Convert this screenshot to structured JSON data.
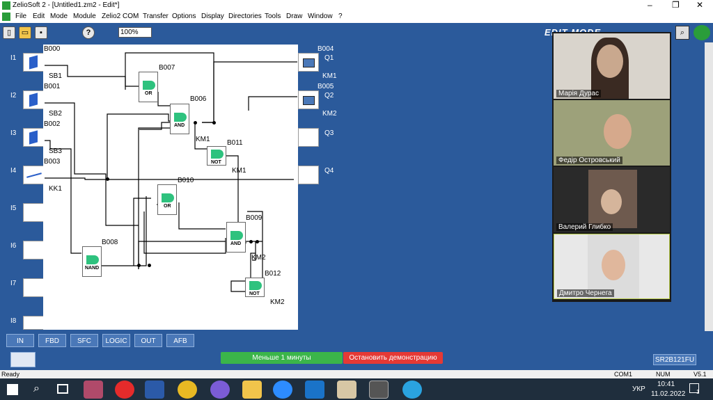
{
  "window": {
    "title": "ZelioSoft 2 - [Untitled1.zm2 - Edit*]",
    "controls": [
      "–",
      "❐",
      "✕"
    ]
  },
  "menu": [
    "File",
    "Edit",
    "Mode",
    "Module",
    "Zelio2 COM",
    "Transfer",
    "Options",
    "Display",
    "Directories",
    "Tools",
    "Draw",
    "Window",
    "?"
  ],
  "toolbar": {
    "zoom": "100%",
    "mode_text": "EDIT MODE"
  },
  "inputs": [
    {
      "name": "I1",
      "block": "B000",
      "tag": "SB1"
    },
    {
      "name": "I2",
      "block": "B001",
      "tag": "SB2"
    },
    {
      "name": "I3",
      "block": "B002",
      "tag": "SB3"
    },
    {
      "name": "I4",
      "block": "B003",
      "tag": "KK1"
    },
    {
      "name": "I5"
    },
    {
      "name": "I6"
    },
    {
      "name": "I7"
    },
    {
      "name": "I8"
    }
  ],
  "outputs": [
    {
      "name": "Q1",
      "block": "B004",
      "tag": "KM1"
    },
    {
      "name": "Q2",
      "block": "B005",
      "tag": "KM2"
    },
    {
      "name": "Q3"
    },
    {
      "name": "Q4"
    }
  ],
  "blocks": [
    {
      "id": "B007",
      "type": "OR"
    },
    {
      "id": "B006",
      "type": "AND"
    },
    {
      "id": "B011",
      "type": "NOT",
      "tag": "KM1"
    },
    {
      "id": "B010",
      "type": "OR"
    },
    {
      "id": "B009",
      "type": "AND",
      "tag": "KM2"
    },
    {
      "id": "B008",
      "type": "NAND"
    },
    {
      "id": "B012",
      "type": "NOT",
      "tag": "KM2"
    }
  ],
  "block_tags": {
    "B006": "KM1"
  },
  "view_tabs": [
    "IN",
    "FBD",
    "SFC",
    "LOGIC",
    "OUT",
    "AFB"
  ],
  "meeting": {
    "timer": "Меньше 1 минуты",
    "stop_label": "Остановить демонстрацию",
    "model": "SR2B121FU"
  },
  "participants": [
    "Марія Дурас",
    "Федір Островський",
    "Валерий Глибко",
    "Дмитро Чернега"
  ],
  "status": {
    "left": "Ready",
    "com": "COM1",
    "num": "NUM",
    "version": "V5.1"
  },
  "taskbar": {
    "lang": "УКР",
    "time": "10:41",
    "date": "11.02.2022",
    "notif": "1"
  }
}
